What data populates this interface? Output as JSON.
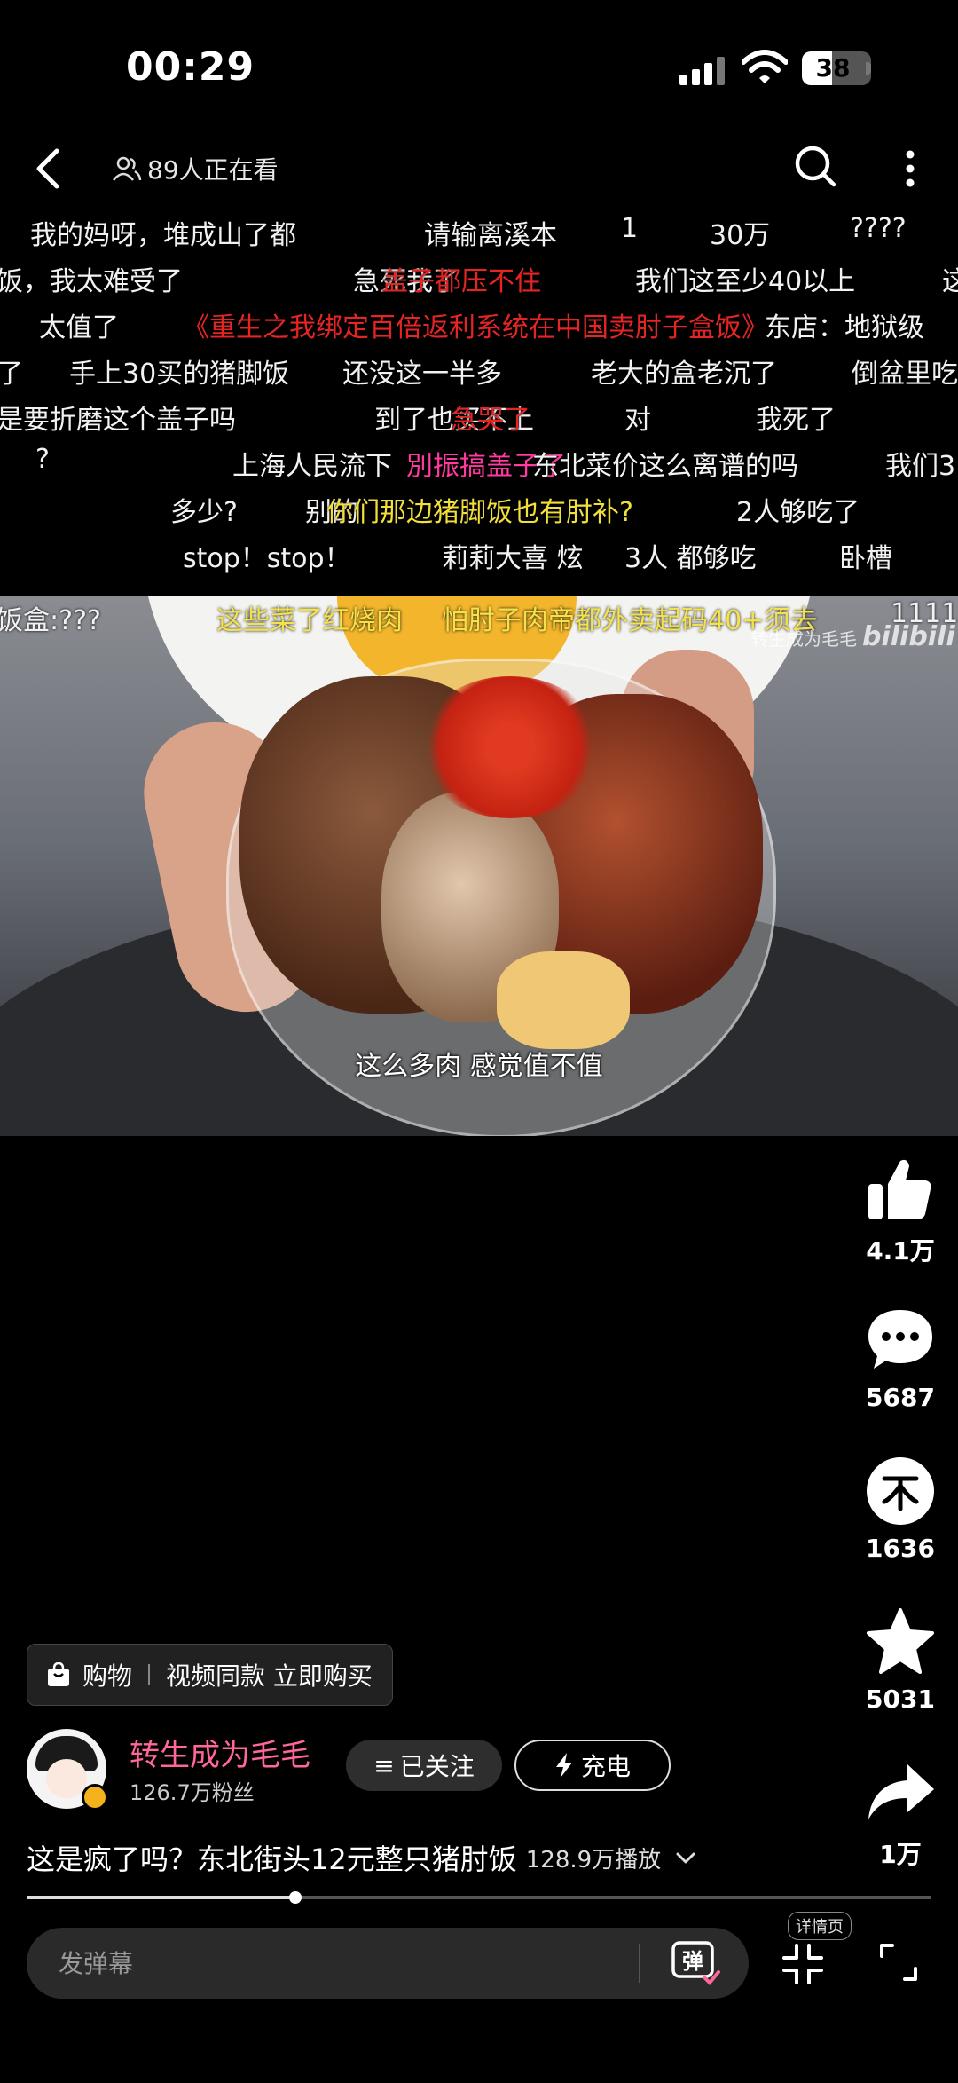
{
  "status_bar": {
    "time": "00:29",
    "battery": "38"
  },
  "topnav": {
    "viewers": "89人正在看"
  },
  "danmaku_rows": [
    [
      {
        "text": "我的妈呀，堆成山了都",
        "color": "white"
      },
      {
        "text": "请输离溪本",
        "color": "white"
      },
      {
        "text": "1",
        "color": "white"
      },
      {
        "text": "30万",
        "color": "white"
      },
      {
        "text": "????",
        "color": "white"
      }
    ],
    [
      {
        "text": "饭，我太难受了",
        "color": "white"
      },
      {
        "text": "急死我了",
        "color": "white"
      },
      {
        "text": "盖子都压不住",
        "color": "red"
      },
      {
        "text": "我们这至少40以上",
        "color": "white"
      },
      {
        "text": "这",
        "color": "white"
      }
    ],
    [
      {
        "text": "太值了",
        "color": "white"
      },
      {
        "text": "《重生之我绑定百倍返利系统在中国卖肘子盒饭》",
        "color": "red"
      },
      {
        "text": "东店：地狱级",
        "color": "white"
      }
    ],
    [
      {
        "text": "了",
        "color": "white"
      },
      {
        "text": "手上30买的猪脚饭",
        "color": "white"
      },
      {
        "text": "还没这一半多",
        "color": "white"
      },
      {
        "text": "老大的盒老沉了",
        "color": "white"
      },
      {
        "text": "倒盆里吃",
        "color": "white"
      }
    ],
    [
      {
        "text": "是要折磨这个盖子吗",
        "color": "white"
      },
      {
        "text": "到了也买不上",
        "color": "white"
      },
      {
        "text": "急哭了",
        "color": "red"
      },
      {
        "text": "对",
        "color": "white"
      },
      {
        "text": "我死了",
        "color": "white"
      }
    ],
    [
      {
        "text": "?",
        "color": "white"
      },
      {
        "text": "上海人民流下",
        "color": "white"
      },
      {
        "text": "別振搞盖子了",
        "color": "pink"
      },
      {
        "text": "东北菜价这么离谱的吗",
        "color": "white"
      },
      {
        "text": "我们3",
        "color": "white"
      }
    ],
    [
      {
        "text": "多少?",
        "color": "white"
      },
      {
        "text": "别的",
        "color": "white"
      },
      {
        "text": "你们那边猪脚饭也有肘补?",
        "color": "yellow"
      },
      {
        "text": "2人够吃了",
        "color": "white"
      }
    ],
    [
      {
        "text": "stop！stop！",
        "color": "white"
      },
      {
        "text": "莉莉大喜 炫",
        "color": "white"
      },
      {
        "text": "3人 都够吃",
        "color": "white"
      },
      {
        "text": "卧槽",
        "color": "white"
      }
    ]
  ],
  "video": {
    "overlay_danmaku": [
      {
        "text": "饭盒:???",
        "color": "white"
      },
      {
        "text": "这些菜了红烧肉",
        "color": "yellow"
      },
      {
        "text": "怕肘子肉帝都外卖起码40+须去",
        "color": "yellow"
      },
      {
        "text": "11111",
        "color": "white"
      }
    ],
    "watermark": "转生成为毛毛",
    "watermark_logo": "bilibili",
    "subtitle": "这么多肉 感觉值不值"
  },
  "actions": [
    {
      "name": "like",
      "count": "4.1万"
    },
    {
      "name": "comment",
      "count": "5687"
    },
    {
      "name": "coin",
      "count": "1636"
    },
    {
      "name": "favorite",
      "count": "5031"
    },
    {
      "name": "share",
      "count": "1万"
    }
  ],
  "shop_tag": {
    "label": "购物",
    "cta": "视频同款 立即购买"
  },
  "uploader": {
    "name": "转生成为毛毛",
    "fans": "126.7万粉丝",
    "follow_label": "已关注",
    "charge_label": "充电"
  },
  "video_info": {
    "title": "这是疯了吗？东北街头12元整只猪肘饭",
    "plays": "128.9万播放"
  },
  "progress": {
    "fraction": 0.297
  },
  "bottom": {
    "danmaku_placeholder": "发弹幕",
    "detail_badge": "详情页"
  },
  "colors": {
    "accent_pink": "#ff6699",
    "danmaku_red": "#e52424",
    "danmaku_yellow": "#f3df3a",
    "background": "#000000"
  }
}
